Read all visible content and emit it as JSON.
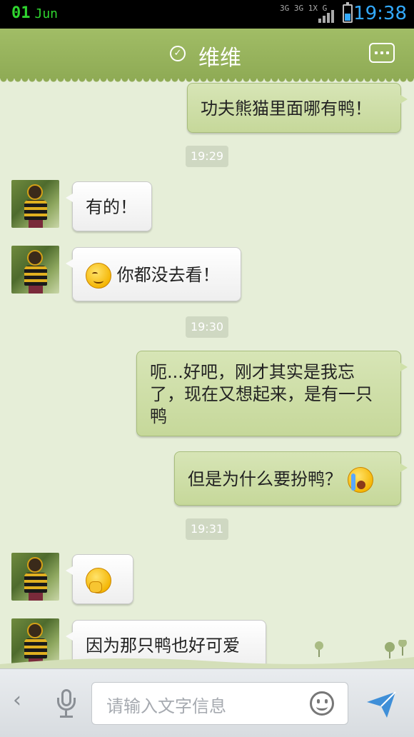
{
  "status_bar": {
    "date_day": "01",
    "date_month": "Jun",
    "network": "3G 3G 1X G",
    "time": "19:38",
    "battery_fill": 0.45
  },
  "header": {
    "title": "维维",
    "verified_icon": "check-circle-icon",
    "more_icon": "more-dots-icon"
  },
  "messages": [
    {
      "side": "right",
      "text": "功夫熊猫里面哪有鸭！"
    },
    {
      "type": "time",
      "text": "19:29"
    },
    {
      "side": "left",
      "text": "有的！"
    },
    {
      "side": "left",
      "emoji": "smug-emoji",
      "text": "你都没去看！"
    },
    {
      "type": "time",
      "text": "19:30"
    },
    {
      "side": "right",
      "text": "呃...好吧，刚才其实是我忘了，现在又想起来，是有一只鸭"
    },
    {
      "side": "right",
      "text": "但是为什么要扮鸭？",
      "emoji": "crying-emoji"
    },
    {
      "type": "time",
      "text": "19:31"
    },
    {
      "side": "left",
      "emoji": "thinking-emoji"
    },
    {
      "side": "left",
      "text": "因为那只鸭也好可爱"
    }
  ],
  "input_bar": {
    "back_glyph": "‹",
    "placeholder": "请输入文字信息",
    "mic_icon": "microphone-icon",
    "emoji_icon": "smiley-icon",
    "send_icon": "send-arrow-icon"
  },
  "colors": {
    "header": "#97b35c",
    "chat_bg": "#e6eed8",
    "bubble_right": "#cfe0a9",
    "bubble_left": "#fafafa",
    "time_green": "#2fd52f",
    "time_blue": "#33aaff"
  }
}
